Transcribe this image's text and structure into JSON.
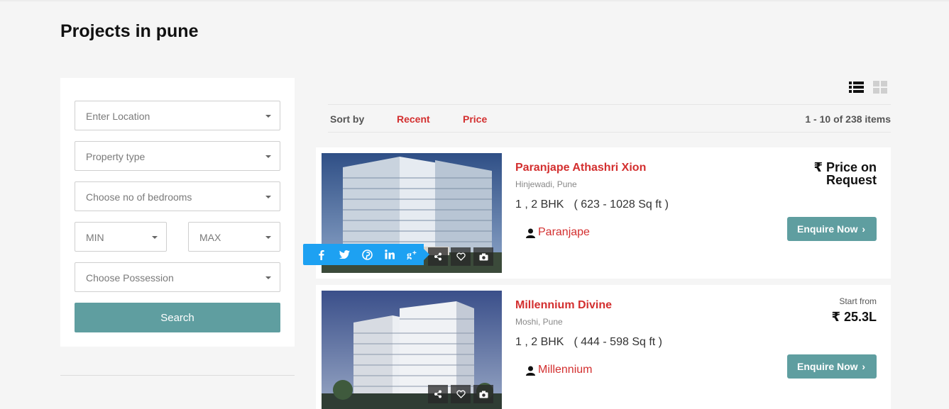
{
  "page": {
    "title": "Projects in pune"
  },
  "filters": {
    "location_placeholder": "Enter Location",
    "property_type_placeholder": "Property type",
    "bedrooms_placeholder": "Choose no of bedrooms",
    "min_placeholder": "MIN",
    "max_placeholder": "MAX",
    "possession_placeholder": "Choose Possession",
    "search_label": "Search"
  },
  "toolbar": {
    "sort_label": "Sort by",
    "sort_recent": "Recent",
    "sort_price": "Price",
    "items_count": "1 - 10 of 238 items",
    "view_icons": [
      "list-view-icon",
      "grid-view-icon"
    ]
  },
  "share_icons": [
    "facebook-icon",
    "twitter-icon",
    "pinterest-icon",
    "linkedin-icon",
    "google-plus-icon"
  ],
  "listings": [
    {
      "title": "Paranjape Athashri Xion",
      "location": "Hinjewadi, Pune",
      "config": "1 , 2 BHK",
      "area": "( 623 - 1028 Sq ft )",
      "builder": "Paranjape",
      "price_line1": "₹ Price on",
      "price_line2": "Request",
      "enquire_label": "Enquire Now"
    },
    {
      "title": "Millennium Divine",
      "location": "Moshi, Pune",
      "config": "1 , 2 BHK",
      "area": "( 444 - 598 Sq ft )",
      "builder": "Millennium",
      "start_from": "Start from",
      "price": "₹ 25.3L",
      "enquire_label": "Enquire Now"
    }
  ],
  "colors": {
    "accent_red": "#d32f2f",
    "button_teal": "#5f9ea0",
    "share_blue": "#1da1f2"
  }
}
